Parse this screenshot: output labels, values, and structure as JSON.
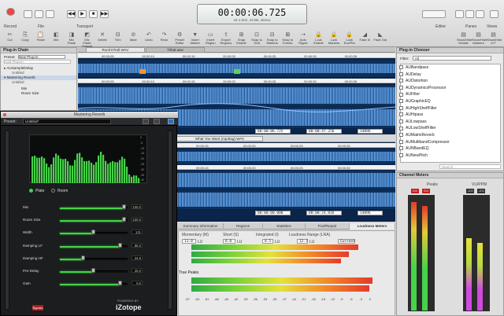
{
  "toolbar": {
    "groups": [
      "Record",
      "File",
      "Transport",
      "Editor",
      "Panes",
      "Views"
    ],
    "tools": [
      "Cut",
      "Copy",
      "Paste",
      "Mix",
      "Mix Paste",
      "Mix Paste Special",
      "Delete",
      "Trim",
      "Mute",
      "Undo",
      "Redo",
      "Preset Editor",
      "Insert Marker",
      "Insert Region",
      "Export Regions",
      "Snap Enable",
      "Snap to Grid",
      "Snap to Markers",
      "Snap to Events",
      "Auto Ripple",
      "Lock Enable",
      "Lock Markers",
      "Lock Env/Pts",
      "Fade In",
      "Fade Out"
    ],
    "right_tools": [
      "Show/Hide Details",
      "Show/Hide Markers",
      "Show/Hide G.F"
    ]
  },
  "transport": {
    "time": "00:00:06.725",
    "format": "44.1 kHz, 24 Bit, stereo"
  },
  "plugin_chain": {
    "title": "Plug-in Chain",
    "preset_label": "Preset:",
    "preset_value": "New Plug-in",
    "add_placeholder": "Add Plug-in",
    "items": [
      {
        "name": "AUSampleDelay",
        "preset": "Untitled"
      },
      {
        "name": "Mastering Reverb",
        "preset": "Untitled"
      }
    ],
    "params": [
      "Mix",
      "Room Size"
    ]
  },
  "files": {
    "tab_active": "Rock'n'Roll.WAV",
    "tab_other": "Tribal.wav"
  },
  "waveform1": {
    "rulers": [
      "00:00:05",
      "00:00:10",
      "00:00:15",
      "00:00:20",
      "00:00:25",
      "00:00:30",
      "00:00:35"
    ],
    "time_start": "00:00:06.725",
    "time_end": "00:00:47.256",
    "time_len": "14096"
  },
  "waveform2": {
    "title": "What You Want (mp3tag).WAV",
    "rulers": [
      "00:00:05",
      "00:00:10",
      "00:00:15",
      "00:00:20",
      "00:00:25",
      "00:00:30"
    ],
    "time_start": "00:00:00.000",
    "time_end": "00:00:24.826",
    "time_len": "14096"
  },
  "reverb": {
    "title": "Mastering Reverb",
    "preset_label": "Preset:",
    "preset_value": "Untitled*",
    "plate_label": "Plate",
    "room_label": "Room",
    "db_ticks": [
      "0",
      "-5",
      "-10",
      "-15",
      "-20",
      "-25",
      "-30",
      "-35",
      "-40"
    ],
    "params": [
      {
        "label": "Mix",
        "value": "100.0",
        "fill": 0.95
      },
      {
        "label": "Room Size",
        "value": "100.0",
        "fill": 0.95
      },
      {
        "label": "Width",
        "value": "121",
        "fill": 0.5
      },
      {
        "label": "Damping LF",
        "value": "88.3",
        "fill": 0.9
      },
      {
        "label": "Damping HF",
        "value": "34.9",
        "fill": 0.35
      },
      {
        "label": "Pre-Delay",
        "value": "25.0",
        "fill": 0.5
      },
      {
        "label": "Gain",
        "value": "0.0",
        "fill": 0.9
      }
    ],
    "brand_top": "POWERED BY",
    "brand": "iZotope",
    "bypass": "Bypass"
  },
  "info_tabs": {
    "tabs": [
      "Summary Information",
      "Regions",
      "Statistics",
      "Find/Repair",
      "Loudness Meters"
    ],
    "active": "Loudness Meters"
  },
  "loudness": {
    "momentary_label": "Momentary (M)",
    "short_label": "Short (S)",
    "integrated_label": "Integrated (I)",
    "lra_label": "Loudness Range (LRA)",
    "momentary": "11.0",
    "short": "8.8",
    "integrated": "8.5",
    "lra": "12.7",
    "unit": "LU",
    "mode": "Current",
    "true_peaks_label": "True Peaks",
    "scale": [
      "-57",
      "-54",
      "-51",
      "-48",
      "-45",
      "-42",
      "-39",
      "-36",
      "-33",
      "-30",
      "-27",
      "-24",
      "-21",
      "-18",
      "-15",
      "-12",
      "-9",
      "-6",
      "-3",
      "0"
    ]
  },
  "plugin_chooser": {
    "title": "Plug-in Chooser",
    "filter_label": "Filter:",
    "filter_value": "All",
    "items": [
      "AUBandpass",
      "AUDelay",
      "AUDistortion",
      "AUDynamicsProcessor",
      "AUFilter",
      "AUGraphicEQ",
      "AUHighShelfFilter",
      "AUHipass",
      "AULowpass",
      "AULowShelfFilter",
      "AUMatrixReverb",
      "AUMultibandCompressor",
      "AUNBandEQ",
      "AUNewPitch"
    ],
    "search_placeholder": "Search"
  },
  "channel_meters": {
    "title": "Channel Meters",
    "peaks_label": "Peaks",
    "vu_label": "VU/PPM",
    "peak_values": [
      "0.0",
      "0.0"
    ],
    "vu_values": [
      "-2.0",
      "-2.0"
    ],
    "levels": {
      "peak_l": 0.93,
      "peak_r": 0.9,
      "vu_l": 0.62,
      "vu_r": 0.58
    }
  },
  "colors": {
    "meter_green": "#46d24a",
    "wave_blue": "#5b9be0",
    "wave_bg": "#0d2f5b",
    "accent": "#2f6fb3"
  }
}
